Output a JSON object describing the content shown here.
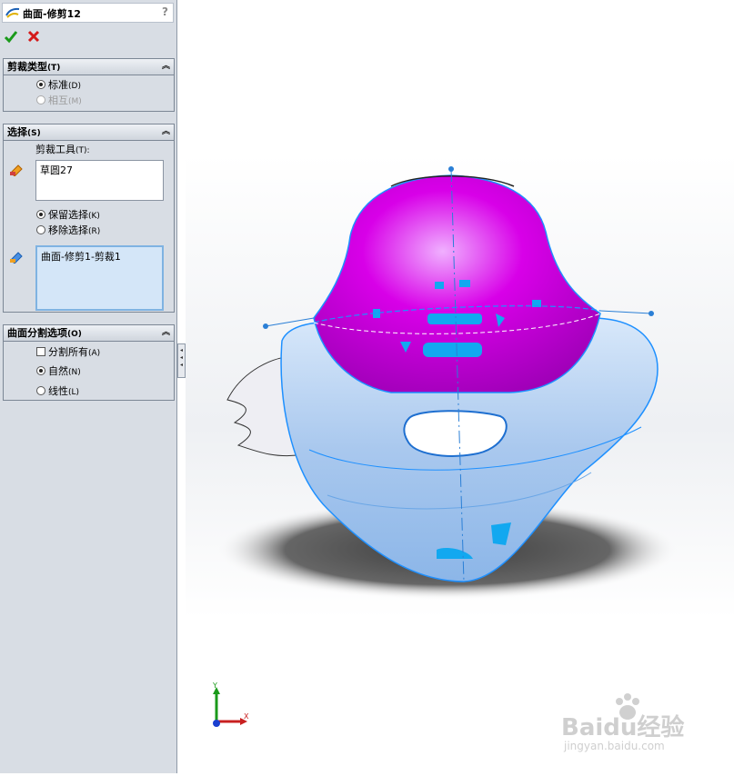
{
  "feature": {
    "title": "曲面-修剪12",
    "help": "?"
  },
  "trim_type": {
    "header": "剪裁类型",
    "header_key": "(T)",
    "options": [
      {
        "label": "标准",
        "key": "(D)",
        "selected": true,
        "enabled": true
      },
      {
        "label": "相互",
        "key": "(M)",
        "selected": false,
        "enabled": false
      }
    ]
  },
  "selections": {
    "header": "选择",
    "header_key": "(S)",
    "trim_tool_label": "剪裁工具",
    "trim_tool_key": "(T):",
    "trim_tool_value": "草圆27",
    "keep": {
      "label": "保留选择",
      "key": "(K)",
      "selected": true
    },
    "remove": {
      "label": "移除选择",
      "key": "(R)",
      "selected": false
    },
    "pieces_value": "曲面-修剪1-剪裁1"
  },
  "split_options": {
    "header": "曲面分割选项",
    "header_key": "(O)",
    "split_all": {
      "label": "分割所有",
      "key": "(A)",
      "checked": false
    },
    "natural": {
      "label": "自然",
      "key": "(N)",
      "selected": true
    },
    "linear": {
      "label": "线性",
      "key": "(L)",
      "selected": false
    }
  },
  "triad": {
    "x": "X",
    "y": "Y"
  },
  "watermark": {
    "brand": "Baidu经验",
    "url": "jingyan.baidu.com"
  },
  "colors": {
    "trim_face": "#d800e8",
    "body_face": "#bcd6f2",
    "selection_edge": "#1e90ff"
  }
}
